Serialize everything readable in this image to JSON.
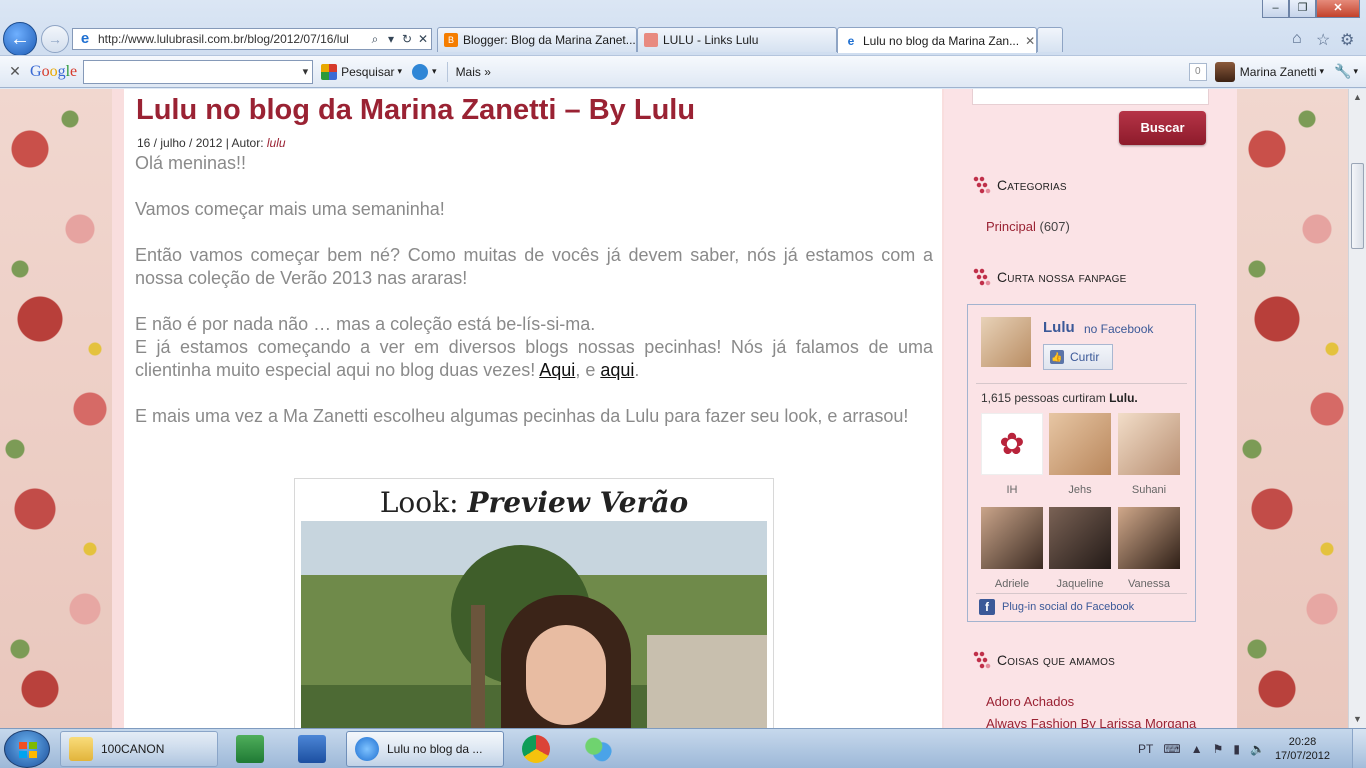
{
  "browser": {
    "address_url": "http://www.lulubrasil.com.br/blog/2012/07/16/lul",
    "tabs": [
      {
        "label": "Blogger: Blog da Marina Zanet...",
        "icon": "blogger-icon",
        "color": "#f57d00"
      },
      {
        "label": "LULU - Links Lulu",
        "icon": "lulu-icon",
        "color": "#e88a80"
      },
      {
        "label": "Lulu no blog da Marina Zan...",
        "icon": "ie-icon",
        "color": "#1e6fd1",
        "active": true
      }
    ],
    "toolbar": {
      "google_label": "Google",
      "pesquisar_label": "Pesquisar",
      "mais_label": "Mais »",
      "badge_count": "0",
      "user_name": "Marina Zanetti"
    }
  },
  "post": {
    "title": "Lulu no blog da Marina Zanetti – By Lulu",
    "meta_prefix": "16 / julho / 2012 | Autor:",
    "author": "lulu",
    "paragraphs": {
      "p1": "Olá meninas!!",
      "p2": "Vamos começar mais uma semaninha!",
      "p3": "Então vamos começar bem né? Como muitas de vocês já devem saber, nós já estamos com a nossa coleção de Verão 2013 nas araras!",
      "p4a": "E não é por nada não … mas a coleção está be-lís-si-ma.",
      "p4b_before": "E já estamos começando a ver em diversos blogs nossas pecinhas! Nós já falamos de uma clientinha muito especial aqui no blog duas vezes!",
      "link1": "Aqui",
      "p4b_mid": ", e",
      "link2": "aqui",
      "p4b_end": ".",
      "p5": "E mais uma vez a Ma Zanetti escolheu algumas pecinhas da Lulu para fazer seu look, e arrasou!"
    },
    "image_caption_prefix": "Look:",
    "image_caption_script": "Preview Verão"
  },
  "sidebar": {
    "search_button": "Buscar",
    "categorias_title": "Categorias",
    "categorias": [
      {
        "label": "Principal",
        "count": "(607)"
      }
    ],
    "fanpage_title": "Curta nossa fanpage",
    "facebook": {
      "page_name": "Lulu",
      "on_facebook": "no Facebook",
      "like_button": "Curtir",
      "count_text": "1,615 pessoas curtiram",
      "count_page": "Lulu.",
      "fans": [
        {
          "name": "IH",
          "color": "#ffffff"
        },
        {
          "name": "Jehs",
          "color": "#c9a07a"
        },
        {
          "name": "Suhani",
          "color": "#d7b79c"
        },
        {
          "name": "Adriele",
          "color": "#5a4538"
        },
        {
          "name": "Jaqueline",
          "color": "#3a2d2a"
        },
        {
          "name": "Vanessa",
          "color": "#4a3526"
        }
      ],
      "plugin_text": "Plug-in social do Facebook"
    },
    "coisas_title": "Coisas que amamos",
    "coisas_links": [
      "Adoro Achados",
      "Always Fashion By Larissa Morgana"
    ]
  },
  "taskbar": {
    "buttons": [
      {
        "label": "100CANON",
        "icon": "folder-icon"
      },
      {
        "label": "Lulu no blog da ...",
        "icon": "ie-icon"
      }
    ],
    "language": "PT",
    "time": "20:28",
    "date": "17/07/2012"
  }
}
